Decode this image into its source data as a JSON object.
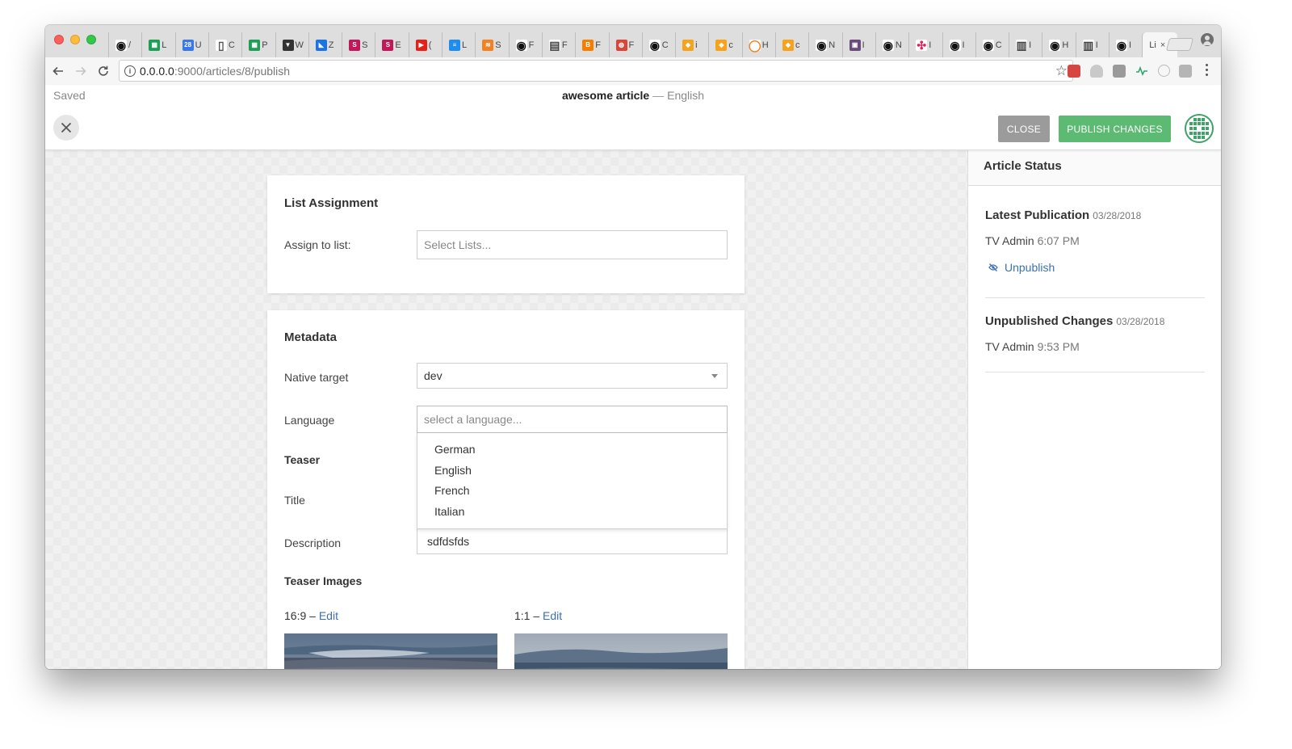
{
  "browser": {
    "tabs": [
      {
        "icon": "github-icon",
        "char": "/",
        "bg": "#ffffff",
        "fg": "#111111",
        "glyph": "◉"
      },
      {
        "icon": "sheets-icon",
        "char": "L",
        "bg": "#1e9e56",
        "fg": "#ffffff",
        "glyph": "▦"
      },
      {
        "icon": "calendar-icon",
        "char": "U",
        "bg": "#3b78e7",
        "fg": "#ffffff",
        "glyph": "28"
      },
      {
        "icon": "document-icon",
        "char": "C",
        "bg": "#ffffff",
        "fg": "#555555",
        "glyph": "▯"
      },
      {
        "icon": "sheets-icon",
        "char": "P",
        "bg": "#1e9e56",
        "fg": "#ffffff",
        "glyph": "▦"
      },
      {
        "icon": "shield-icon",
        "char": "W",
        "bg": "#333333",
        "fg": "#ffffff",
        "glyph": "▼"
      },
      {
        "icon": "chart-icon",
        "char": "Z",
        "bg": "#1a73e8",
        "fg": "#ffffff",
        "glyph": "◣"
      },
      {
        "icon": "s-brand-icon",
        "char": "S",
        "bg": "#c2185b",
        "fg": "#ffffff",
        "glyph": "S"
      },
      {
        "icon": "s-brand-icon",
        "char": "E",
        "bg": "#c2185b",
        "fg": "#ffffff",
        "glyph": "S"
      },
      {
        "icon": "youtube-icon",
        "char": "(",
        "bg": "#e62117",
        "fg": "#ffffff",
        "glyph": "▶"
      },
      {
        "icon": "intercom-icon",
        "char": "L",
        "bg": "#1f8ded",
        "fg": "#ffffff",
        "glyph": "≡"
      },
      {
        "icon": "stack-icon",
        "char": "S",
        "bg": "#f48024",
        "fg": "#ffffff",
        "glyph": "≋"
      },
      {
        "icon": "github-icon",
        "char": "F",
        "bg": "#ffffff",
        "fg": "#111111",
        "glyph": "◉"
      },
      {
        "icon": "reader-icon",
        "char": "F",
        "bg": "#ffffff",
        "fg": "#444444",
        "glyph": "▤"
      },
      {
        "icon": "blogger-icon",
        "char": "F",
        "bg": "#f57d00",
        "fg": "#ffffff",
        "glyph": "B"
      },
      {
        "icon": "chrome-icon",
        "char": "F",
        "bg": "#db4437",
        "fg": "#ffffff",
        "glyph": "◍"
      },
      {
        "icon": "github-icon",
        "char": "C",
        "bg": "#ffffff",
        "fg": "#111111",
        "glyph": "◉"
      },
      {
        "icon": "book-icon",
        "char": "i",
        "bg": "#f7a21b",
        "fg": "#ffffff",
        "glyph": "◆"
      },
      {
        "icon": "book-icon",
        "char": "c",
        "bg": "#f7a21b",
        "fg": "#ffffff",
        "glyph": "◆"
      },
      {
        "icon": "circle-icon",
        "char": "H",
        "bg": "#ffffff",
        "fg": "#f48024",
        "glyph": "◯"
      },
      {
        "icon": "book-icon",
        "char": "c",
        "bg": "#f7a21b",
        "fg": "#ffffff",
        "glyph": "◆"
      },
      {
        "icon": "github-icon",
        "char": "N",
        "bg": "#ffffff",
        "fg": "#111111",
        "glyph": "◉"
      },
      {
        "icon": "photo-icon",
        "char": "I",
        "bg": "#6a4c7a",
        "fg": "#ffffff",
        "glyph": "▣"
      },
      {
        "icon": "github-icon",
        "char": "N",
        "bg": "#ffffff",
        "fg": "#111111",
        "glyph": "◉"
      },
      {
        "icon": "slack-icon",
        "char": "I",
        "bg": "#ffffff",
        "fg": "#e01e5a",
        "glyph": "✣"
      },
      {
        "icon": "github-icon",
        "char": "I",
        "bg": "#ffffff",
        "fg": "#111111",
        "glyph": "◉"
      },
      {
        "icon": "github-icon",
        "char": "C",
        "bg": "#ffffff",
        "fg": "#111111",
        "glyph": "◉"
      },
      {
        "icon": "reader-icon",
        "char": "I",
        "bg": "#ffffff",
        "fg": "#444444",
        "glyph": "▥"
      },
      {
        "icon": "github-icon",
        "char": "H",
        "bg": "#ffffff",
        "fg": "#111111",
        "glyph": "◉"
      },
      {
        "icon": "reader-icon",
        "char": "I",
        "bg": "#ffffff",
        "fg": "#444444",
        "glyph": "▥"
      },
      {
        "icon": "github-icon",
        "char": "I",
        "bg": "#ffffff",
        "fg": "#111111",
        "glyph": "◉"
      }
    ],
    "active_tab": {
      "char": "Li",
      "close": "×"
    },
    "url_host": "0.0.0.0",
    "url_path": ":9000/articles/8/publish"
  },
  "header": {
    "saved_status": "Saved",
    "article_title": "awesome article",
    "separator": "—",
    "language": "English",
    "close_label": "CLOSE",
    "publish_label": "PUBLISH CHANGES"
  },
  "list_assignment": {
    "title": "List Assignment",
    "assign_label": "Assign to list:",
    "assign_placeholder": "Select Lists..."
  },
  "metadata": {
    "title": "Metadata",
    "native_target_label": "Native target",
    "native_target_value": "dev",
    "language_label": "Language",
    "language_placeholder": "select a language...",
    "language_options": [
      "German",
      "English",
      "French",
      "Italian"
    ],
    "teaser_heading": "Teaser",
    "title_label": "Title",
    "description_label": "Description",
    "description_value": "sdfdsfds",
    "teaser_images_heading": "Teaser Images",
    "ratio_1_label": "16:9",
    "ratio_2_label": "1:1",
    "ratio_dash": "–",
    "edit_label": "Edit"
  },
  "sidebar": {
    "title": "Article Status",
    "latest_publication": {
      "label": "Latest Publication",
      "date": "03/28/2018",
      "user": "TV Admin",
      "time": "6:07 PM",
      "action": "Unpublish"
    },
    "unpublished_changes": {
      "label": "Unpublished Changes",
      "date": "03/28/2018",
      "user": "TV Admin",
      "time": "9:53 PM"
    }
  },
  "colors": {
    "primary_green": "#5cba73",
    "close_gray": "#9b9b9b",
    "link_blue": "#3c6fb3"
  }
}
